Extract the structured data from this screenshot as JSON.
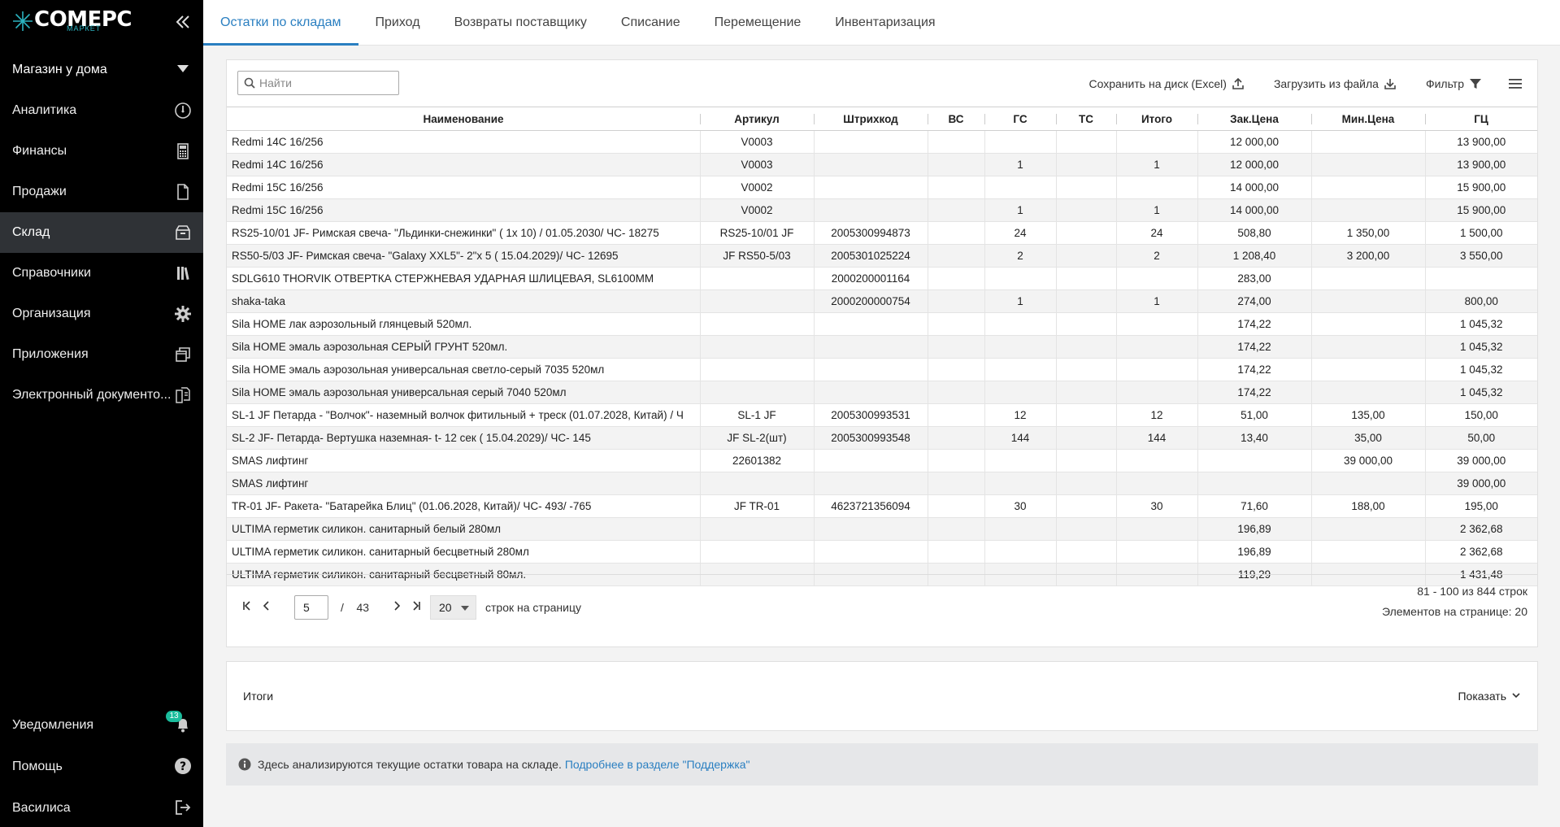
{
  "sidebar": {
    "logo_text": "СОМЕРС",
    "logo_sub": "МАРКЕТ",
    "store_name": "Магазин у дома",
    "items": [
      {
        "label": "Аналитика",
        "icon": "gauge-icon"
      },
      {
        "label": "Финансы",
        "icon": "calculator-icon"
      },
      {
        "label": "Продажи",
        "icon": "document-icon"
      },
      {
        "label": "Склад",
        "icon": "box-icon",
        "active": true
      },
      {
        "label": "Справочники",
        "icon": "books-icon"
      },
      {
        "label": "Организация",
        "icon": "gear-icon"
      },
      {
        "label": "Приложения",
        "icon": "windows-icon"
      },
      {
        "label": "Электронный документо...",
        "icon": "documents-icon"
      }
    ],
    "bottom": {
      "notifications": "Уведомления",
      "notif_count": "13",
      "help": "Помощь",
      "user": "Василиса"
    }
  },
  "tabs": [
    {
      "label": "Остатки по складам",
      "active": true
    },
    {
      "label": "Приход"
    },
    {
      "label": "Возвраты поставщику"
    },
    {
      "label": "Списание"
    },
    {
      "label": "Перемещение"
    },
    {
      "label": "Инвентаризация"
    }
  ],
  "toolbar": {
    "search_placeholder": "Найти",
    "save_excel": "Сохранить на диск (Excel)",
    "upload": "Загрузить из файла",
    "filter": "Фильтр"
  },
  "table": {
    "columns": [
      "Наименование",
      "Артикул",
      "Штрихкод",
      "ВС",
      "ГС",
      "ТС",
      "Итого",
      "Зак.Цена",
      "Мин.Цена",
      "ГЦ"
    ],
    "rows": [
      [
        "Redmi 14C 16/256",
        "V0003",
        "",
        "",
        "",
        "",
        "",
        "12 000,00",
        "",
        "13 900,00"
      ],
      [
        "Redmi 14C 16/256",
        "V0003",
        "",
        "",
        "1",
        "",
        "1",
        "12 000,00",
        "",
        "13 900,00"
      ],
      [
        "Redmi 15C 16/256",
        "V0002",
        "",
        "",
        "",
        "",
        "",
        "14 000,00",
        "",
        "15 900,00"
      ],
      [
        "Redmi 15C 16/256",
        "V0002",
        "",
        "",
        "1",
        "",
        "1",
        "14 000,00",
        "",
        "15 900,00"
      ],
      [
        "RS25-10/01 JF- Римская свеча- \"Льдинки-снежинки\" ( 1x 10) / 01.05.2030/ ЧС- 18275",
        "RS25-10/01 JF",
        "2005300994873",
        "",
        "24",
        "",
        "24",
        "508,80",
        "1 350,00",
        "1 500,00"
      ],
      [
        "RS50-5/03 JF- Римская свеча- \"Galaxy XXL5\"- 2\"x 5 ( 15.04.2029)/ ЧС- 12695",
        "JF RS50-5/03",
        "2005301025224",
        "",
        "2",
        "",
        "2",
        "1 208,40",
        "3 200,00",
        "3 550,00"
      ],
      [
        "SDLG610 THORVIK ОТВЕРТКА СТЕРЖНЕВАЯ УДАРНАЯ ШЛИЦЕВАЯ, SL6100MM",
        "",
        "2000200001164",
        "",
        "",
        "",
        "",
        "283,00",
        "",
        ""
      ],
      [
        "shaka-taka",
        "",
        "2000200000754",
        "",
        "1",
        "",
        "1",
        "274,00",
        "",
        "800,00"
      ],
      [
        "Sila HOME лак аэрозольный глянцевый 520мл.",
        "",
        "",
        "",
        "",
        "",
        "",
        "174,22",
        "",
        "1 045,32"
      ],
      [
        "Sila HOME эмаль аэрозольная СЕРЫЙ ГРУНТ 520мл.",
        "",
        "",
        "",
        "",
        "",
        "",
        "174,22",
        "",
        "1 045,32"
      ],
      [
        "Sila HOME эмаль аэрозольная универсальная светло-серый 7035 520мл",
        "",
        "",
        "",
        "",
        "",
        "",
        "174,22",
        "",
        "1 045,32"
      ],
      [
        "Sila HOME эмаль аэрозольная универсальная серый 7040 520мл",
        "",
        "",
        "",
        "",
        "",
        "",
        "174,22",
        "",
        "1 045,32"
      ],
      [
        "SL-1 JF Петарда - \"Волчок\"- наземный волчок фитильный + треск (01.07.2028, Китай) / Ч",
        "SL-1 JF",
        "2005300993531",
        "",
        "12",
        "",
        "12",
        "51,00",
        "135,00",
        "150,00"
      ],
      [
        "SL-2 JF- Петарда- Вертушка наземная- t- 12 сек ( 15.04.2029)/ ЧС- 145",
        "JF SL-2(шт)",
        "2005300993548",
        "",
        "144",
        "",
        "144",
        "13,40",
        "35,00",
        "50,00"
      ],
      [
        "SMAS лифтинг",
        "22601382",
        "",
        "",
        "",
        "",
        "",
        "",
        "39 000,00",
        "39 000,00"
      ],
      [
        "SMAS лифтинг",
        "",
        "",
        "",
        "",
        "",
        "",
        "",
        "",
        "39 000,00"
      ],
      [
        "TR-01 JF- Ракета- \"Батарейка Блиц\" (01.06.2028, Китай)/ ЧС- 493/ -765",
        "JF TR-01",
        "4623721356094",
        "",
        "30",
        "",
        "30",
        "71,60",
        "188,00",
        "195,00"
      ],
      [
        "ULTIMA герметик силикон. санитарный белый 280мл",
        "",
        "",
        "",
        "",
        "",
        "",
        "196,89",
        "",
        "2 362,68"
      ],
      [
        "ULTIMA герметик силикон. санитарный бесцветный 280мл",
        "",
        "",
        "",
        "",
        "",
        "",
        "196,89",
        "",
        "2 362,68"
      ],
      [
        "ULTIMA герметик силикон. санитарный бесцветный 80мл.",
        "",
        "",
        "",
        "",
        "",
        "",
        "119,29",
        "",
        "1 431,48"
      ]
    ]
  },
  "pager": {
    "page": "5",
    "of": "/",
    "total_pages": "43",
    "per_page": "20",
    "per_page_label": "строк на страницу",
    "range": "81 - 100 из 844 строк",
    "items_on_page": "Элементов на странице: 20"
  },
  "totals": {
    "title": "Итоги",
    "show": "Показать"
  },
  "info": {
    "text": "Здесь анализируются текущие остатки товара на складе.",
    "link": "Подробнее в разделе \"Поддержка\""
  },
  "colors": {
    "accent": "#2a7fc1",
    "sidebar_bg": "#000000",
    "active_item": "#2f3236",
    "badge": "#1abc9c"
  }
}
